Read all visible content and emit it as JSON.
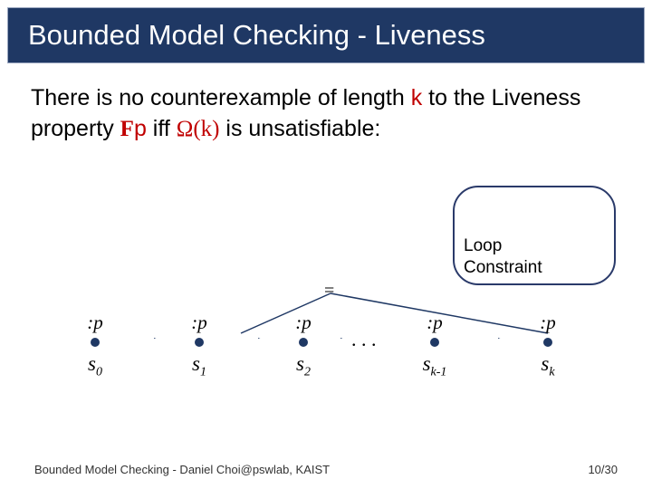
{
  "title": "Bounded Model Checking - Liveness",
  "body": {
    "pre": "There is no counterexample of length ",
    "k": "k",
    "mid": " to the Liveness property ",
    "Fp_F": "F",
    "Fp_p": "p",
    "iff": " iff ",
    "omega": "Ω(k)",
    "post": " is unsatisfiable:"
  },
  "loop_label_l1": "Loop",
  "loop_label_l2": "Constraint",
  "equals": "=",
  "ellipsis": ". . .",
  "states": [
    {
      "neg": ":p",
      "label_var": "s",
      "label_sub": "0"
    },
    {
      "neg": ":p",
      "label_var": "s",
      "label_sub": "1"
    },
    {
      "neg": ":p",
      "label_var": "s",
      "label_sub": "2"
    },
    {
      "neg": ":p",
      "label_var": "s",
      "label_sub": "k-1"
    },
    {
      "neg": ":p",
      "label_var": "s",
      "label_sub": "k"
    }
  ],
  "footer_left": "Bounded Model Checking - Daniel Choi@pswlab, KAIST",
  "footer_right": "10/30"
}
